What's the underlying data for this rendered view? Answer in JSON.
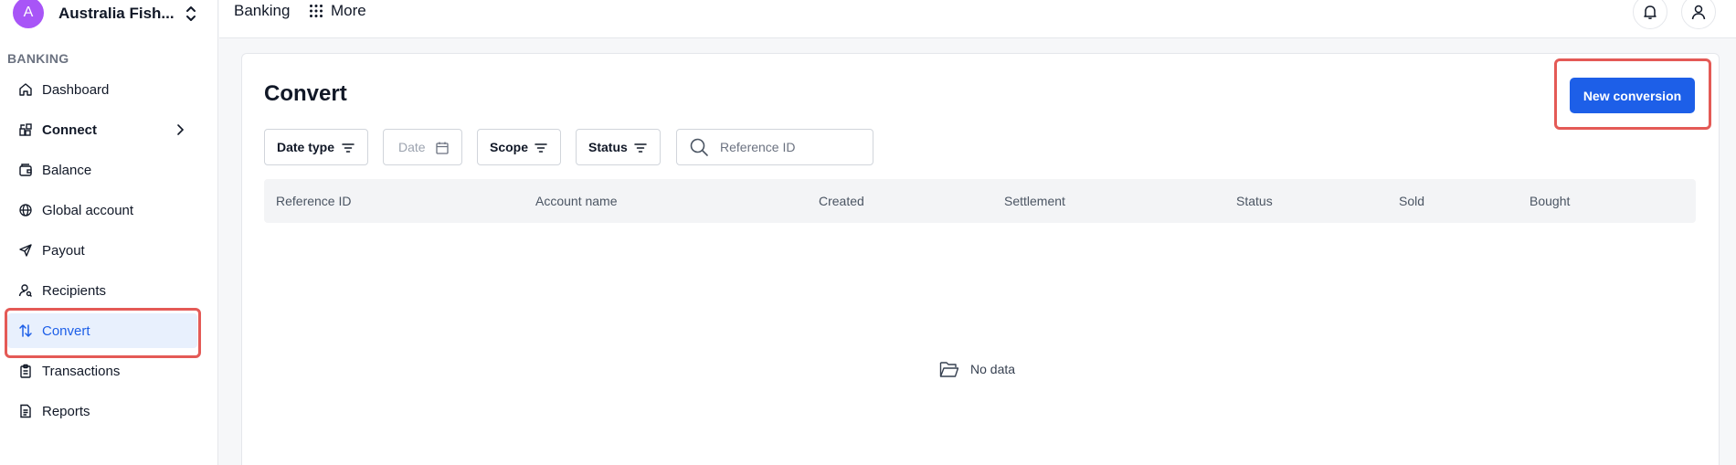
{
  "org": {
    "initial": "A",
    "name": "Australia Fish..."
  },
  "sidebar": {
    "section_label": "BANKING",
    "items": [
      {
        "label": "Dashboard",
        "icon": "home-icon"
      },
      {
        "label": "Connect",
        "icon": "connect-icon"
      },
      {
        "label": "Balance",
        "icon": "wallet-icon"
      },
      {
        "label": "Global account",
        "icon": "globe-icon"
      },
      {
        "label": "Payout",
        "icon": "send-icon"
      },
      {
        "label": "Recipients",
        "icon": "user-search-icon"
      },
      {
        "label": "Convert",
        "icon": "arrows-swap-icon"
      },
      {
        "label": "Transactions",
        "icon": "clipboard-icon"
      },
      {
        "label": "Reports",
        "icon": "document-icon"
      }
    ]
  },
  "topbar": {
    "breadcrumb": "Banking",
    "more_label": "More"
  },
  "page": {
    "title": "Convert",
    "primary_button": "New conversion",
    "filters": {
      "date_type": "Date type",
      "date": "Date",
      "scope": "Scope",
      "status": "Status",
      "search_placeholder": "Reference ID"
    },
    "table": {
      "columns": [
        "Reference ID",
        "Account name",
        "Created",
        "Settlement",
        "Status",
        "Sold",
        "Bought"
      ],
      "rows": [],
      "empty_text": "No data"
    }
  },
  "colors": {
    "accent": "#1d5fe8",
    "active_bg": "#e8f0fd",
    "avatar": "#a855f7",
    "highlight": "#e45a56"
  }
}
